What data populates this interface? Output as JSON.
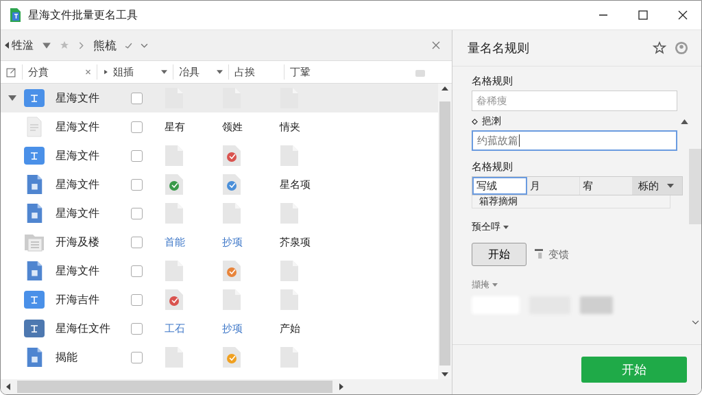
{
  "window": {
    "title": "星海文件批量更名工具"
  },
  "toolbar": {
    "back_label": "牲湓",
    "path_label": "熊梳"
  },
  "columns": [
    {
      "label": "分賁",
      "kind": "close"
    },
    {
      "label": "爼插",
      "kind": "dropdown"
    },
    {
      "label": "冶具",
      "kind": "dropdown"
    },
    {
      "label": "占挨",
      "kind": "plain"
    },
    {
      "label": "丁鞏",
      "kind": "plain"
    }
  ],
  "rows": [
    {
      "kind": "tile",
      "name": "星海文件",
      "selected": true,
      "expanded": true,
      "checked": false,
      "cells": [
        {
          "kind": "file"
        },
        {
          "kind": "file"
        },
        {
          "kind": "file"
        }
      ]
    },
    {
      "kind": "page",
      "name": "星海文件",
      "selected": false,
      "checked": false,
      "cells": [
        {
          "kind": "text",
          "text": "星有",
          "link": false
        },
        {
          "kind": "text",
          "text": "领姓",
          "link": false
        },
        {
          "kind": "text",
          "text": "情夹",
          "link": false
        }
      ]
    },
    {
      "kind": "tile",
      "name": "星海文件",
      "selected": false,
      "checked": false,
      "cells": [
        {
          "kind": "file"
        },
        {
          "kind": "app",
          "color": "#d9534f"
        },
        {
          "kind": "file"
        }
      ]
    },
    {
      "kind": "blue-file",
      "name": "星海文件",
      "selected": false,
      "checked": false,
      "cells": [
        {
          "kind": "app",
          "color": "#3a9a4a"
        },
        {
          "kind": "app",
          "color": "#4a8fd9"
        },
        {
          "kind": "text",
          "text": "星名项",
          "link": false
        }
      ]
    },
    {
      "kind": "blue-file",
      "name": "星海文件",
      "selected": false,
      "checked": false,
      "cells": [
        {
          "kind": "file"
        },
        {
          "kind": "file"
        },
        {
          "kind": "file"
        }
      ]
    },
    {
      "kind": "folder",
      "name": "开海及楼",
      "selected": false,
      "checked": false,
      "cells": [
        {
          "kind": "text",
          "text": "首能",
          "link": true
        },
        {
          "kind": "text",
          "text": "抄项",
          "link": true
        },
        {
          "kind": "text",
          "text": "芥泉项",
          "link": false
        }
      ]
    },
    {
      "kind": "blue-file",
      "name": "星海文件",
      "selected": false,
      "checked": false,
      "cells": [
        {
          "kind": "file"
        },
        {
          "kind": "app",
          "color": "#e8843a"
        },
        {
          "kind": "file"
        }
      ]
    },
    {
      "kind": "tile",
      "name": "开海吉件",
      "selected": false,
      "checked": false,
      "cells": [
        {
          "kind": "app",
          "color": "#d9534f"
        },
        {
          "kind": "file"
        },
        {
          "kind": "file"
        }
      ]
    },
    {
      "kind": "dark-tile",
      "name": "星海任文件",
      "selected": false,
      "checked": false,
      "cells": [
        {
          "kind": "text",
          "text": "工石",
          "link": true
        },
        {
          "kind": "text",
          "text": "抄项",
          "link": true
        },
        {
          "kind": "text",
          "text": "产始",
          "link": false
        }
      ]
    },
    {
      "kind": "blue-file",
      "name": "揭能",
      "selected": false,
      "checked": false,
      "cells": [
        {
          "kind": "file"
        },
        {
          "kind": "app",
          "color": "#f0a020"
        },
        {
          "kind": "file"
        }
      ]
    }
  ],
  "panel": {
    "title": "量名名规则",
    "rule_label": "名格规则",
    "rule_placeholder": "畚稀痩",
    "section_label": "挹溂",
    "section_expanded": true,
    "section_value": "约菰故篇",
    "format_label": "名格规则",
    "segments": [
      {
        "label": "写绒",
        "selected": true
      },
      {
        "label": "月",
        "selected": false
      },
      {
        "label": "宥",
        "selected": false
      }
    ],
    "dropdown": "栎的",
    "list_item": "箱荐摘炯",
    "preview_label": "预仝哹",
    "start_small": "开始",
    "change_label": "变馈",
    "more_label": "擷掩",
    "start": "开始"
  }
}
